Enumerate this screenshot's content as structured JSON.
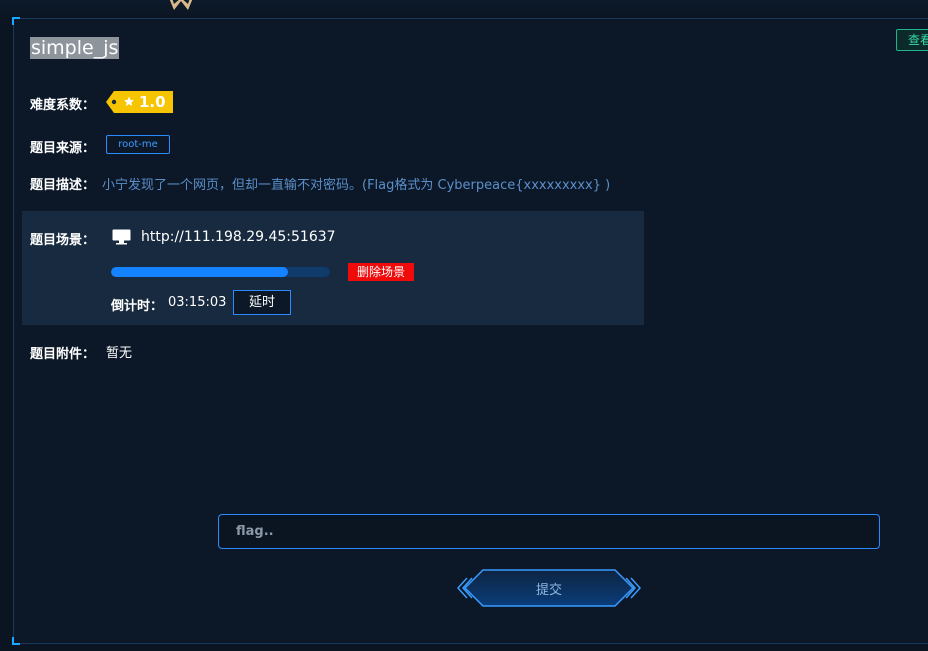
{
  "challenge": {
    "title": "simple_js",
    "view_button": "查看",
    "difficulty_label": "难度系数：",
    "difficulty_value": "1.0",
    "source_label": "题目来源：",
    "source_value": "root-me",
    "description_label": "题目描述：",
    "description_text": "小宁发现了一个网页，但却一直输不对密码。(Flag格式为 Cyberpeace{xxxxxxxxx} )",
    "scene_label": "题目场景：",
    "scene_url": "http://111.198.29.45:51637",
    "scene_progress": 0.81,
    "delete_button": "删除场景",
    "countdown_label": "倒计时：",
    "countdown_value": "03:15:03",
    "extend_button": "延时",
    "attachment_label": "题目附件：",
    "attachment_value": "暂无"
  },
  "submit": {
    "placeholder": "flag..",
    "button_label": "提交"
  },
  "colors": {
    "accent": "#2a8bff",
    "danger": "#f00a0a",
    "badge_yellow": "#f7c500",
    "view_green": "#36d9a4",
    "description_text": "#5a8fc9"
  }
}
